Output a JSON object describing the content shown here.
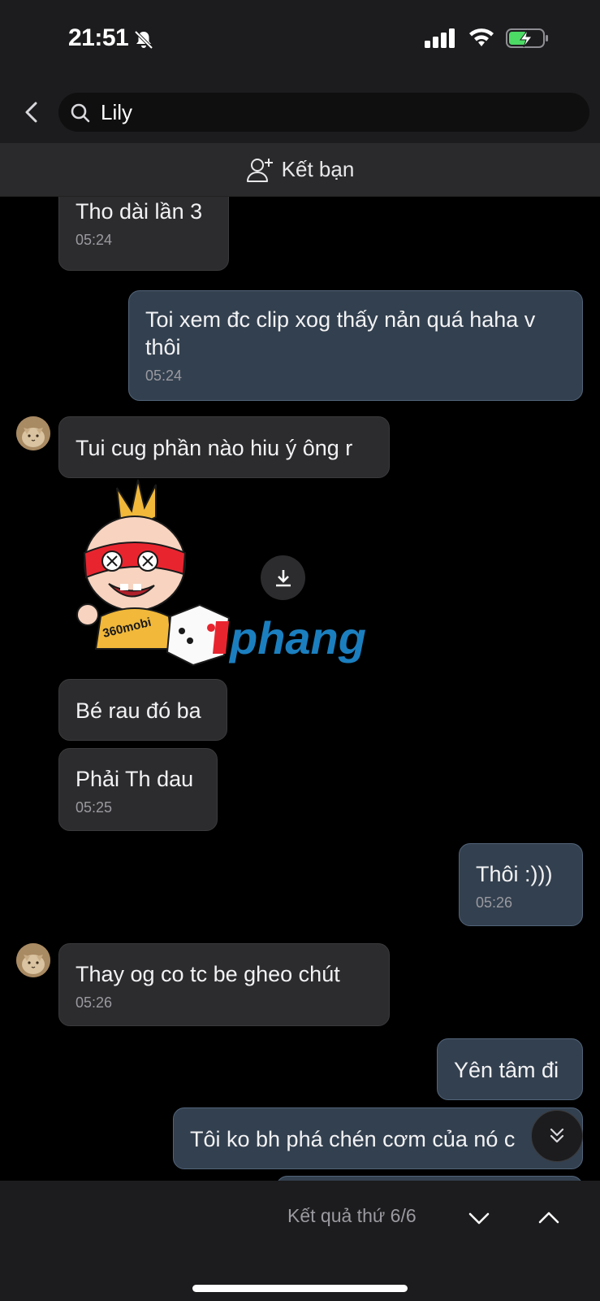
{
  "status_bar": {
    "time": "21:51"
  },
  "header": {
    "search": {
      "value": "Lily",
      "placeholder": ""
    },
    "add_friend_label": "Kết bạn"
  },
  "messages": [
    {
      "side": "in",
      "text": "Tho dài lần 3",
      "time": "05:24"
    },
    {
      "side": "out",
      "text": "Toi xem đc clip xog thấy nản quá haha v thôi",
      "time": "05:24"
    },
    {
      "side": "in",
      "text": "Tui cug phần nào hiu ý ông r",
      "time": ""
    },
    {
      "side": "in",
      "type": "sticker",
      "sticker_text": "360mobi",
      "watermark": "phang"
    },
    {
      "side": "in",
      "text": "Bé rau đó ba",
      "time": ""
    },
    {
      "side": "in",
      "text": "Phải Th dau",
      "time": "05:25"
    },
    {
      "side": "out",
      "text": "Thôi :)))",
      "time": "05:26"
    },
    {
      "side": "in",
      "text": "Thay og co tc be gheo chút",
      "time": "05:26"
    },
    {
      "side": "out",
      "text": "Yên tâm đi",
      "time": ""
    },
    {
      "side": "out",
      "text": "Tôi ko bh phá chén cơm của nó c",
      "time": ""
    }
  ],
  "bottom_bar": {
    "result_label": "Kết quả thứ 6/6"
  },
  "icons": {
    "back": "chevron-left-icon",
    "search": "search-icon",
    "add_friend": "add-user-icon",
    "download": "download-icon",
    "scroll": "double-chevron-down-icon",
    "next": "chevron-down-icon",
    "prev": "chevron-up-icon"
  },
  "colors": {
    "background": "#000000",
    "incoming_bubble": "#2c2c2e",
    "outgoing_bubble": "#33404f",
    "battery_charging": "#4cd964"
  }
}
